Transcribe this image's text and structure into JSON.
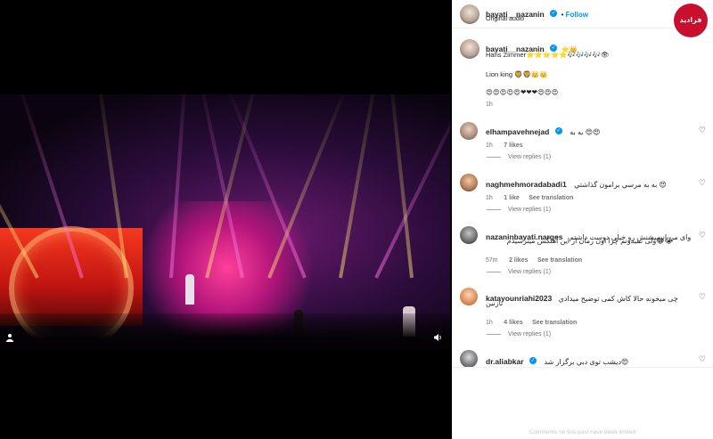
{
  "post": {
    "author": "bayati__nazanin",
    "follow_label": "Follow",
    "audio": "Original audio",
    "caption_line1": "Hans Zimmer⭐⭐⭐⭐⭐🎶🎶🎶🎶👁",
    "caption_line2": "Lion king 🦁🦁👑👑",
    "caption_line3": "😍😍😍😍😍❤❤❤😍😍😍",
    "caption_author_emoji": "⭐👑",
    "caption_time": "1h"
  },
  "brand_badge": "فرادید",
  "comments": [
    {
      "username": "elhampavehnejad",
      "text": "به به 😍😍",
      "time": "1h",
      "likes": "7 likes",
      "translate": "",
      "view_replies": "View replies (1)"
    },
    {
      "username": "naghmehmoradabadi1",
      "text": "به به مرسي برامون گذاشتي 😍",
      "time": "1h",
      "likes": "1 like",
      "translate": "See translation",
      "view_replies": "View replies (1)"
    },
    {
      "username": "nazaninbayati.narges",
      "text": "واى من انيميشنش رو خيلي دوست داشتم",
      "text2": "ولى نميدونم چرا اون زمان از اين آهنگش ميترسيدم😂😭",
      "time": "57m",
      "likes": "2 likes",
      "translate": "See translation",
      "view_replies": "View replies (1)"
    },
    {
      "username": "katayounriahi2023",
      "text": "چى ميخونه حالا كاش كمى توضيح ميدادي",
      "text2": "نازنين",
      "time": "1h",
      "likes": "4 likes",
      "translate": "See translation",
      "view_replies": "View replies (1)"
    },
    {
      "username": "dr.aliabkar",
      "text": "ديشب توى دبي برگزار شد😍",
      "time": "",
      "likes": "",
      "translate": "",
      "view_replies": ""
    }
  ],
  "footer": "Comments on this post have been limited",
  "icons": {
    "heart": "heart-icon",
    "verified": "verified-badge-icon",
    "user": "user-tag-icon",
    "mute": "speaker-icon"
  },
  "colors": {
    "accent": "#0095f6",
    "badge": "#c8102e"
  }
}
